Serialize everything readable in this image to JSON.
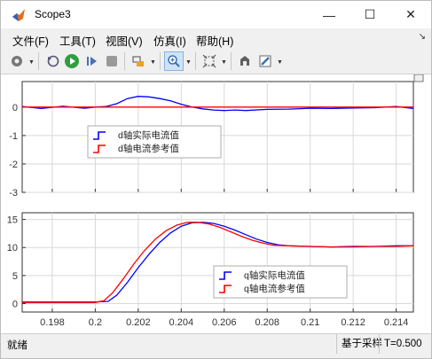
{
  "window": {
    "title": "Scope3",
    "minimize": "—",
    "maximize": "☐",
    "close": "✕"
  },
  "menu": [
    "文件(F)",
    "工具(T)",
    "视图(V)",
    "仿真(I)",
    "帮助(H)"
  ],
  "toolbar_icons": [
    "settings-icon",
    "restore-icon",
    "run-icon",
    "step-forward-icon",
    "stop-icon",
    "highlight-icon",
    "zoom-icon",
    "fit-icon",
    "pan-icon",
    "style-icon"
  ],
  "colors": {
    "series1": "#0000ff",
    "series2": "#ff0000",
    "grid": "#d8d8d8"
  },
  "status": {
    "left": "就绪",
    "mode": "基于采样",
    "time": "T=0.500"
  },
  "chart_data": [
    {
      "type": "line",
      "x_ticks": [
        0.198,
        0.2,
        0.202,
        0.204,
        0.206,
        0.208,
        0.21,
        0.212,
        0.214
      ],
      "x_tick_labels": [
        "0.198",
        "0.2",
        "0.202",
        "0.204",
        "0.206",
        "0.208",
        "0.21",
        "0.212",
        "0.214"
      ],
      "xlim": [
        0.1966,
        0.2148
      ],
      "ylim": [
        -3,
        0.9
      ],
      "y_ticks": [
        0,
        -1,
        -2,
        -3
      ],
      "y_tick_labels": [
        "0",
        "-1",
        "-2",
        "-3"
      ],
      "legend_position": "middle-left",
      "series": [
        {
          "name": "d轴实际电流值",
          "color": "#0000ff",
          "x": [
            0.1966,
            0.1975,
            0.1985,
            0.1995,
            0.2,
            0.2005,
            0.201,
            0.2015,
            0.202,
            0.2025,
            0.203,
            0.2035,
            0.204,
            0.2045,
            0.205,
            0.2055,
            0.206,
            0.2065,
            0.207,
            0.208,
            0.209,
            0.21,
            0.211,
            0.212,
            0.213,
            0.214,
            0.2148
          ],
          "values": [
            0.02,
            -0.05,
            0.03,
            -0.04,
            0.0,
            0.02,
            0.12,
            0.3,
            0.38,
            0.36,
            0.3,
            0.22,
            0.1,
            0.0,
            -0.06,
            -0.1,
            -0.12,
            -0.1,
            -0.12,
            -0.08,
            -0.07,
            -0.04,
            -0.05,
            -0.03,
            -0.02,
            0.02,
            -0.05
          ]
        },
        {
          "name": "d轴电流参考值",
          "color": "#ff0000",
          "x": [
            0.1966,
            0.2148
          ],
          "values": [
            0,
            0
          ]
        }
      ]
    },
    {
      "type": "line",
      "x_ticks": [
        0.198,
        0.2,
        0.202,
        0.204,
        0.206,
        0.208,
        0.21,
        0.212,
        0.214
      ],
      "x_tick_labels": [
        "0.198",
        "0.2",
        "0.202",
        "0.204",
        "0.206",
        "0.208",
        "0.21",
        "0.212",
        "0.214"
      ],
      "xlim": [
        0.1966,
        0.2148
      ],
      "ylim": [
        -1.5,
        16.2
      ],
      "y_ticks": [
        0,
        5,
        10,
        15
      ],
      "y_tick_labels": [
        "0",
        "5",
        "10",
        "15"
      ],
      "legend_position": "bottom-right",
      "series": [
        {
          "name": "q轴实际电流值",
          "color": "#0000ff",
          "x": [
            0.1966,
            0.198,
            0.199,
            0.2,
            0.2006,
            0.201,
            0.2015,
            0.202,
            0.2025,
            0.203,
            0.2035,
            0.204,
            0.2045,
            0.205,
            0.2055,
            0.206,
            0.2065,
            0.207,
            0.2075,
            0.208,
            0.2085,
            0.209,
            0.21,
            0.211,
            0.212,
            0.213,
            0.214,
            0.2148
          ],
          "values": [
            0.3,
            0.3,
            0.3,
            0.3,
            0.4,
            1.5,
            3.8,
            6.4,
            8.8,
            10.9,
            12.6,
            13.8,
            14.4,
            14.5,
            14.3,
            13.8,
            13.1,
            12.3,
            11.5,
            10.9,
            10.5,
            10.3,
            10.2,
            10.1,
            10.2,
            10.2,
            10.3,
            10.3
          ]
        },
        {
          "name": "q轴电流参考值",
          "color": "#ff0000",
          "x": [
            0.1966,
            0.198,
            0.199,
            0.2,
            0.2004,
            0.2008,
            0.2013,
            0.2018,
            0.2023,
            0.2028,
            0.2033,
            0.2038,
            0.2043,
            0.2048,
            0.2053,
            0.2058,
            0.2063,
            0.2068,
            0.2073,
            0.2078,
            0.2083,
            0.209,
            0.21,
            0.211,
            0.212,
            0.213,
            0.214,
            0.2148
          ],
          "values": [
            0.2,
            0.2,
            0.2,
            0.2,
            0.5,
            1.9,
            4.4,
            7.1,
            9.5,
            11.5,
            13.0,
            14.0,
            14.5,
            14.5,
            14.2,
            13.6,
            12.8,
            12.0,
            11.3,
            10.8,
            10.4,
            10.3,
            10.2,
            10.1,
            10.1,
            10.2,
            10.2,
            10.3
          ]
        }
      ]
    }
  ]
}
